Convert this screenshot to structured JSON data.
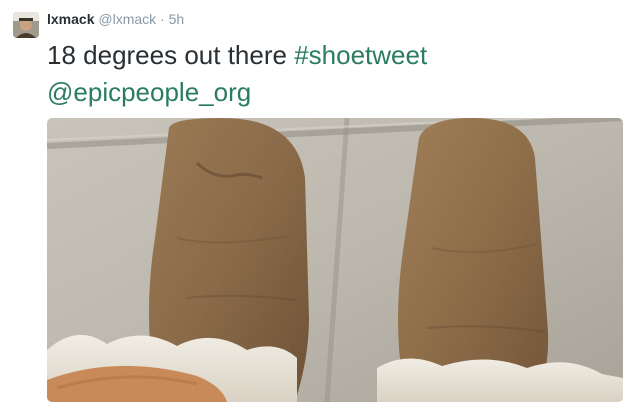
{
  "tweet": {
    "display_name": "lxmack",
    "handle": "@lxmack",
    "separator": "·",
    "time": "5h",
    "text": "18 degrees out there ",
    "hashtag": "#shoetweet",
    "mention": "@epicpeople_org",
    "avatar_icon": "user-avatar",
    "link_color": "#2b7c62",
    "photo_subject": "boots-photo"
  }
}
